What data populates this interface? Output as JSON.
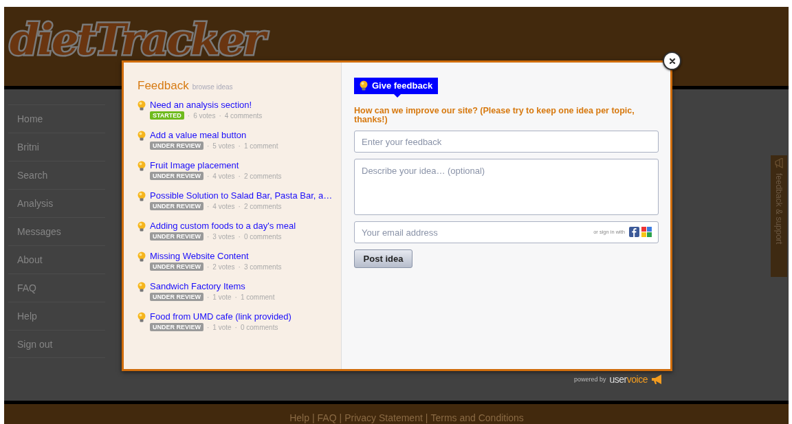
{
  "site": {
    "logo": "dietTracker",
    "nav": [
      {
        "label": "Home"
      },
      {
        "label": "Britni"
      },
      {
        "label": "Search"
      },
      {
        "label": "Analysis"
      },
      {
        "label": "Messages"
      },
      {
        "label": "About"
      },
      {
        "label": "FAQ"
      },
      {
        "label": "Help"
      },
      {
        "label": "Sign out"
      }
    ],
    "footer_links": [
      "Help",
      "FAQ",
      "Privacy Statement",
      "Terms and Conditions"
    ],
    "footer_separator": "|"
  },
  "side_tab": {
    "label": "feedback & support"
  },
  "modal": {
    "title": "Feedback",
    "subtitle": "browse ideas",
    "ideas": [
      {
        "title": "Need an analysis section!",
        "status": "STARTED",
        "color": "#6fba1d",
        "votes": "6 votes",
        "comments": "4 comments"
      },
      {
        "title": "Add a value meal button",
        "status": "UNDER REVIEW",
        "color": "#9a9a9a",
        "votes": "5 votes",
        "comments": "1 comment"
      },
      {
        "title": "Fruit Image placement",
        "status": "UNDER REVIEW",
        "color": "#9a9a9a",
        "votes": "4 votes",
        "comments": "2 comments"
      },
      {
        "title": "Possible Solution to Salad Bar, Pasta Bar, a…",
        "status": "UNDER REVIEW",
        "color": "#9a9a9a",
        "votes": "4 votes",
        "comments": "2 comments"
      },
      {
        "title": "Adding custom foods to a day's meal",
        "status": "UNDER REVIEW",
        "color": "#9a9a9a",
        "votes": "3 votes",
        "comments": "0 comments"
      },
      {
        "title": "Missing Website Content",
        "status": "UNDER REVIEW",
        "color": "#9a9a9a",
        "votes": "2 votes",
        "comments": "3 comments"
      },
      {
        "title": "Sandwich Factory Items",
        "status": "UNDER REVIEW",
        "color": "#9a9a9a",
        "votes": "1 vote",
        "comments": "1 comment"
      },
      {
        "title": "Food from UMD cafe (link provided)",
        "status": "UNDER REVIEW",
        "color": "#9a9a9a",
        "votes": "1 vote",
        "comments": "0 comments"
      }
    ],
    "meta_separator": "·",
    "give_feedback": "Give feedback",
    "prompt": "How can we improve our site? (Please try to keep one idea per topic, thanks!)",
    "fields": [
      {
        "kind": "input",
        "placeholder": "Enter your feedback"
      },
      {
        "kind": "textarea",
        "placeholder": "Describe your idea… (optional)"
      },
      {
        "kind": "email",
        "placeholder": "Your email address",
        "sign_in_label": "or sign in with"
      }
    ],
    "submit": "Post idea",
    "powered_by": "powered by",
    "brand_user": "user",
    "brand_voice": "voice"
  }
}
